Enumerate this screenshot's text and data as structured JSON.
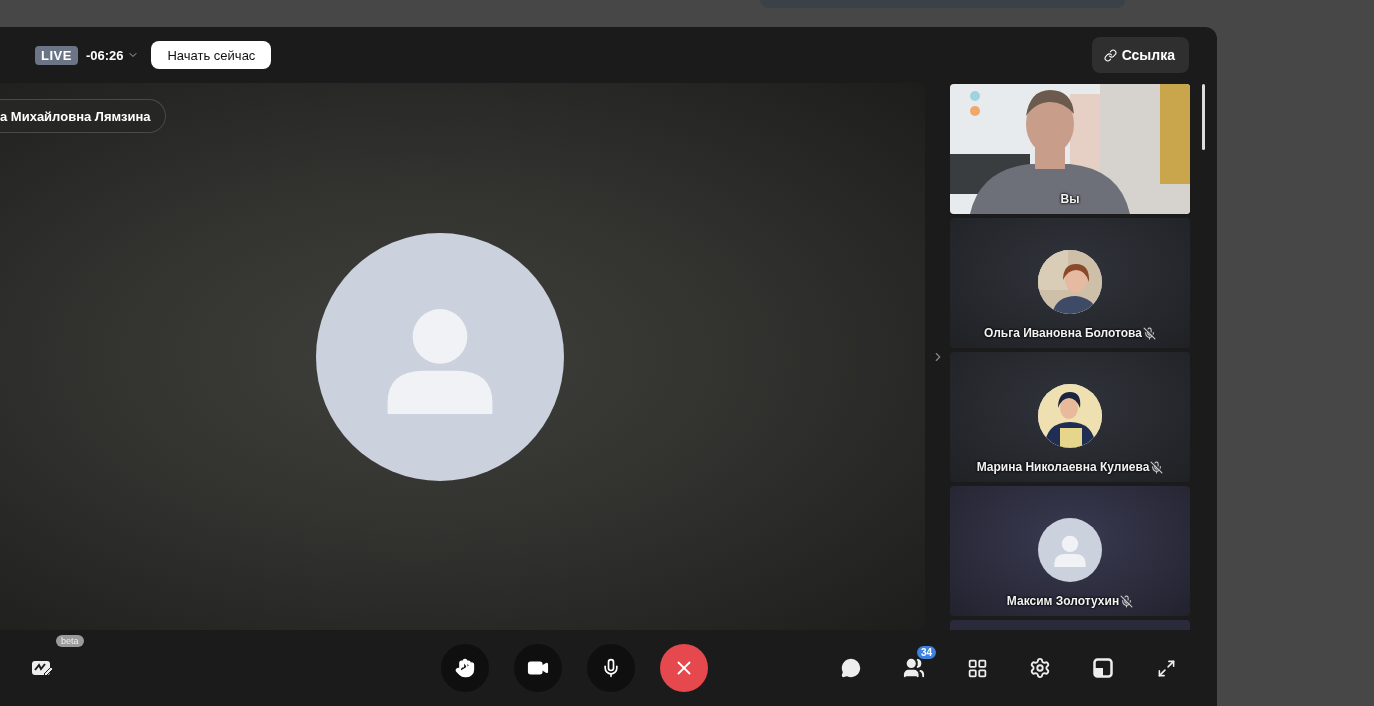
{
  "header": {
    "live_label": "LIVE",
    "timer": "-06:26",
    "start_button": "Начать сейчас",
    "link_button": "Ссылка"
  },
  "speaker": {
    "name": "а Михайловна Лямзина"
  },
  "participants": [
    {
      "name": "Вы",
      "kind": "video",
      "muted": false
    },
    {
      "name": "Ольга Ивановна Болотова",
      "muted": true
    },
    {
      "name": "Марина Николаевна Кулиева",
      "muted": true
    },
    {
      "name": "Максим Золотухин",
      "kind": "placeholder",
      "muted": true
    }
  ],
  "toolbar": {
    "beta_badge": "beta",
    "participants_count": "34"
  }
}
